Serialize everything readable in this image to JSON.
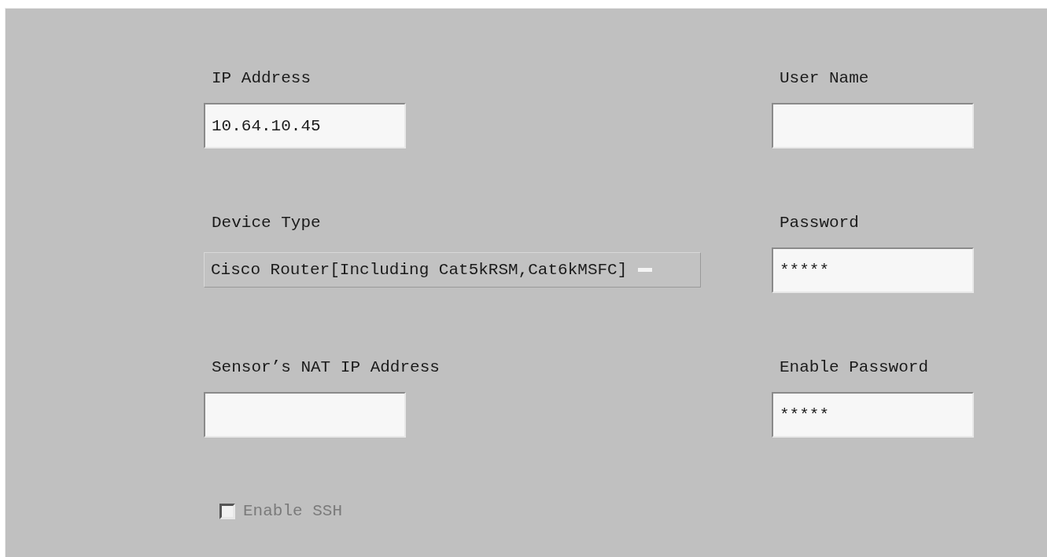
{
  "left_fields": [
    {
      "label": "IP Address",
      "kind": "text",
      "value": "10.64.10.45"
    },
    {
      "label": "Device Type",
      "kind": "dropdown",
      "value": "Cisco Router[Including Cat5kRSM,Cat6kMSFC]"
    },
    {
      "label": "Sensor’s NAT IP Address",
      "kind": "text"
    }
  ],
  "right_fields": [
    {
      "label": "User Name",
      "kind": "text"
    },
    {
      "label": "Password",
      "kind": "text",
      "value": "*****"
    },
    {
      "label": "Enable Password",
      "kind": "text",
      "value": "*****"
    }
  ],
  "checkbox": {
    "label": "Enable SSH",
    "checked": false,
    "disabled": true
  }
}
